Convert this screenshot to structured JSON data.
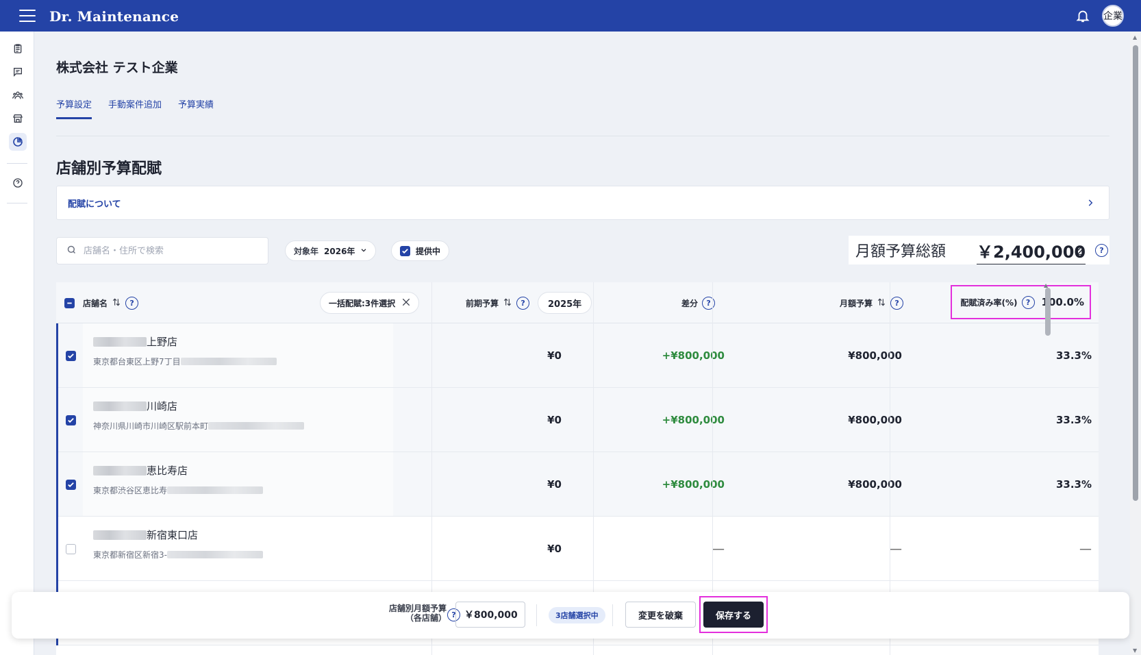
{
  "app": {
    "title": "Dr. Maintenance",
    "avatar_label": "企業"
  },
  "page": {
    "company_name": "株式会社 テスト企業"
  },
  "tabs": [
    {
      "label": "予算設定",
      "active": true
    },
    {
      "label": "手動案件追加",
      "active": false
    },
    {
      "label": "予算実績",
      "active": false
    }
  ],
  "section": {
    "title": "店舗別予算配賦",
    "info_link": "配賦について"
  },
  "filters": {
    "search_placeholder": "店舗名・住所で検索",
    "target_year_label": "対象年",
    "target_year_value": "2026年",
    "providing_label": "提供中",
    "providing_checked": true
  },
  "total": {
    "label": "月額予算総額",
    "value": "￥2,400,000"
  },
  "table": {
    "headers": {
      "store": "店舗名",
      "bulk_chip": "一括配賦:3件選択",
      "prev_budget": "前期予算",
      "prev_year": "2025年",
      "diff": "差分",
      "monthly": "月額予算",
      "rate": "配賦済み率(%)",
      "rate_total": "100.0%"
    },
    "rows": [
      {
        "checked": true,
        "name": "上野店",
        "address": "東京都台東区上野7丁目",
        "prev": "¥0",
        "diff": "+¥800,000",
        "monthly": "¥800,000",
        "rate": "33.3%"
      },
      {
        "checked": true,
        "name": "川崎店",
        "address": "神奈川県川崎市川崎区駅前本町",
        "prev": "¥0",
        "diff": "+¥800,000",
        "monthly": "¥800,000",
        "rate": "33.3%"
      },
      {
        "checked": true,
        "name": "恵比寿店",
        "address": "東京都渋谷区恵比寿",
        "prev": "¥0",
        "diff": "+¥800,000",
        "monthly": "¥800,000",
        "rate": "33.3%"
      },
      {
        "checked": false,
        "name": "新宿東口店",
        "address": "東京都新宿区新宿3-",
        "prev": "¥0",
        "diff": "—",
        "monthly": "—",
        "rate": "—"
      }
    ]
  },
  "footer": {
    "label_line1": "店舗別月額予算",
    "label_line2": "（各店舗）",
    "input_value": "￥800,000",
    "selected_badge": "3店舗選択中",
    "discard_label": "変更を破棄",
    "save_label": "保存する"
  },
  "colors": {
    "brand": "#2443a6",
    "positive": "#2e8b3e",
    "highlight": "#e32fdc",
    "save_button": "#1c2030"
  }
}
